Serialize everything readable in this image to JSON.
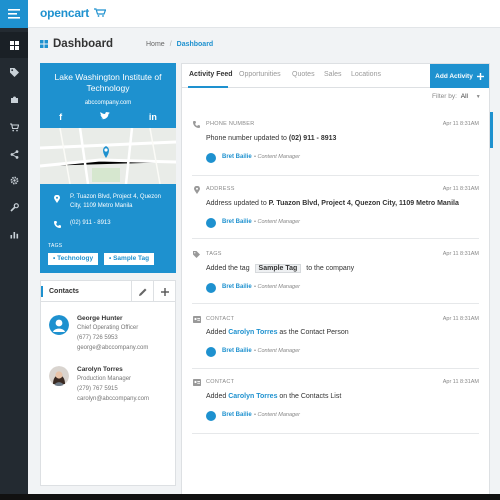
{
  "app": {
    "logo": "opencart"
  },
  "header": {
    "title": "Dashboard",
    "breadcrumb": [
      "Home",
      "Dashboard"
    ]
  },
  "sidebar": {
    "icons": [
      "dashboard-icon",
      "tag-icon",
      "puzzle-icon",
      "cart-icon",
      "share-icon",
      "gear-icon",
      "wrench-icon",
      "chart-icon"
    ]
  },
  "organization": {
    "name": "Lake Washington Institute of Technology",
    "website": "abccompany.com",
    "social": [
      "f",
      "t",
      "in"
    ],
    "address": "P. Tuazon Blvd, Project 4, Quezon City, 1109 Metro Manila",
    "phone": "(02) 911 - 8913",
    "tags_label": "TAGS",
    "tags": [
      "Technology",
      "Sample Tag"
    ]
  },
  "contacts": {
    "title": "Contacts",
    "items": [
      {
        "name": "George Hunter",
        "title": "Chief Operating Officer",
        "phone": "(677) 726 5953",
        "email": "george@abccompany.com"
      },
      {
        "name": "Carolyn Torres",
        "title": "Production Manager",
        "phone": "(279) 767 5915",
        "email": "carolyn@abccompany.com"
      }
    ]
  },
  "feed": {
    "tabs": [
      "Activity Feed",
      "Opportunities",
      "Quotes",
      "Sales",
      "Locations"
    ],
    "add_label": "Add Activity",
    "filter_label": "Filter by:",
    "filter_value": "All",
    "entries": [
      {
        "type": "PHONE NUMBER",
        "time": "Apr 11 8:31AM",
        "pre": "Phone number updated to ",
        "value": "(02) 911 - 8913",
        "post": "",
        "style": "bold"
      },
      {
        "type": "ADDRESS",
        "time": "Apr 11 8:31AM",
        "pre": "Address updated to ",
        "value": "P. Tuazon Blvd, Project 4, Quezon City, 1109 Metro Manila",
        "post": "",
        "style": "bold"
      },
      {
        "type": "TAGS",
        "time": "Apr 11 8:31AM",
        "pre": "Added the tag ",
        "value": "Sample Tag",
        "post": " to the company",
        "style": "pill"
      },
      {
        "type": "CONTACT",
        "time": "Apr 11 8:31AM",
        "pre": "Added ",
        "value": "Carolyn Torres",
        "post": " as the Contact Person",
        "style": "link"
      },
      {
        "type": "CONTACT",
        "time": "Apr 11 8:31AM",
        "pre": "Added ",
        "value": "Carolyn Torres",
        "post": " on the Contacts List",
        "style": "link"
      }
    ],
    "author_name": "Bret Bailie",
    "author_role": "Content Manager"
  },
  "colors": {
    "accent": "#1e91cf",
    "sidebar": "#232a31"
  }
}
